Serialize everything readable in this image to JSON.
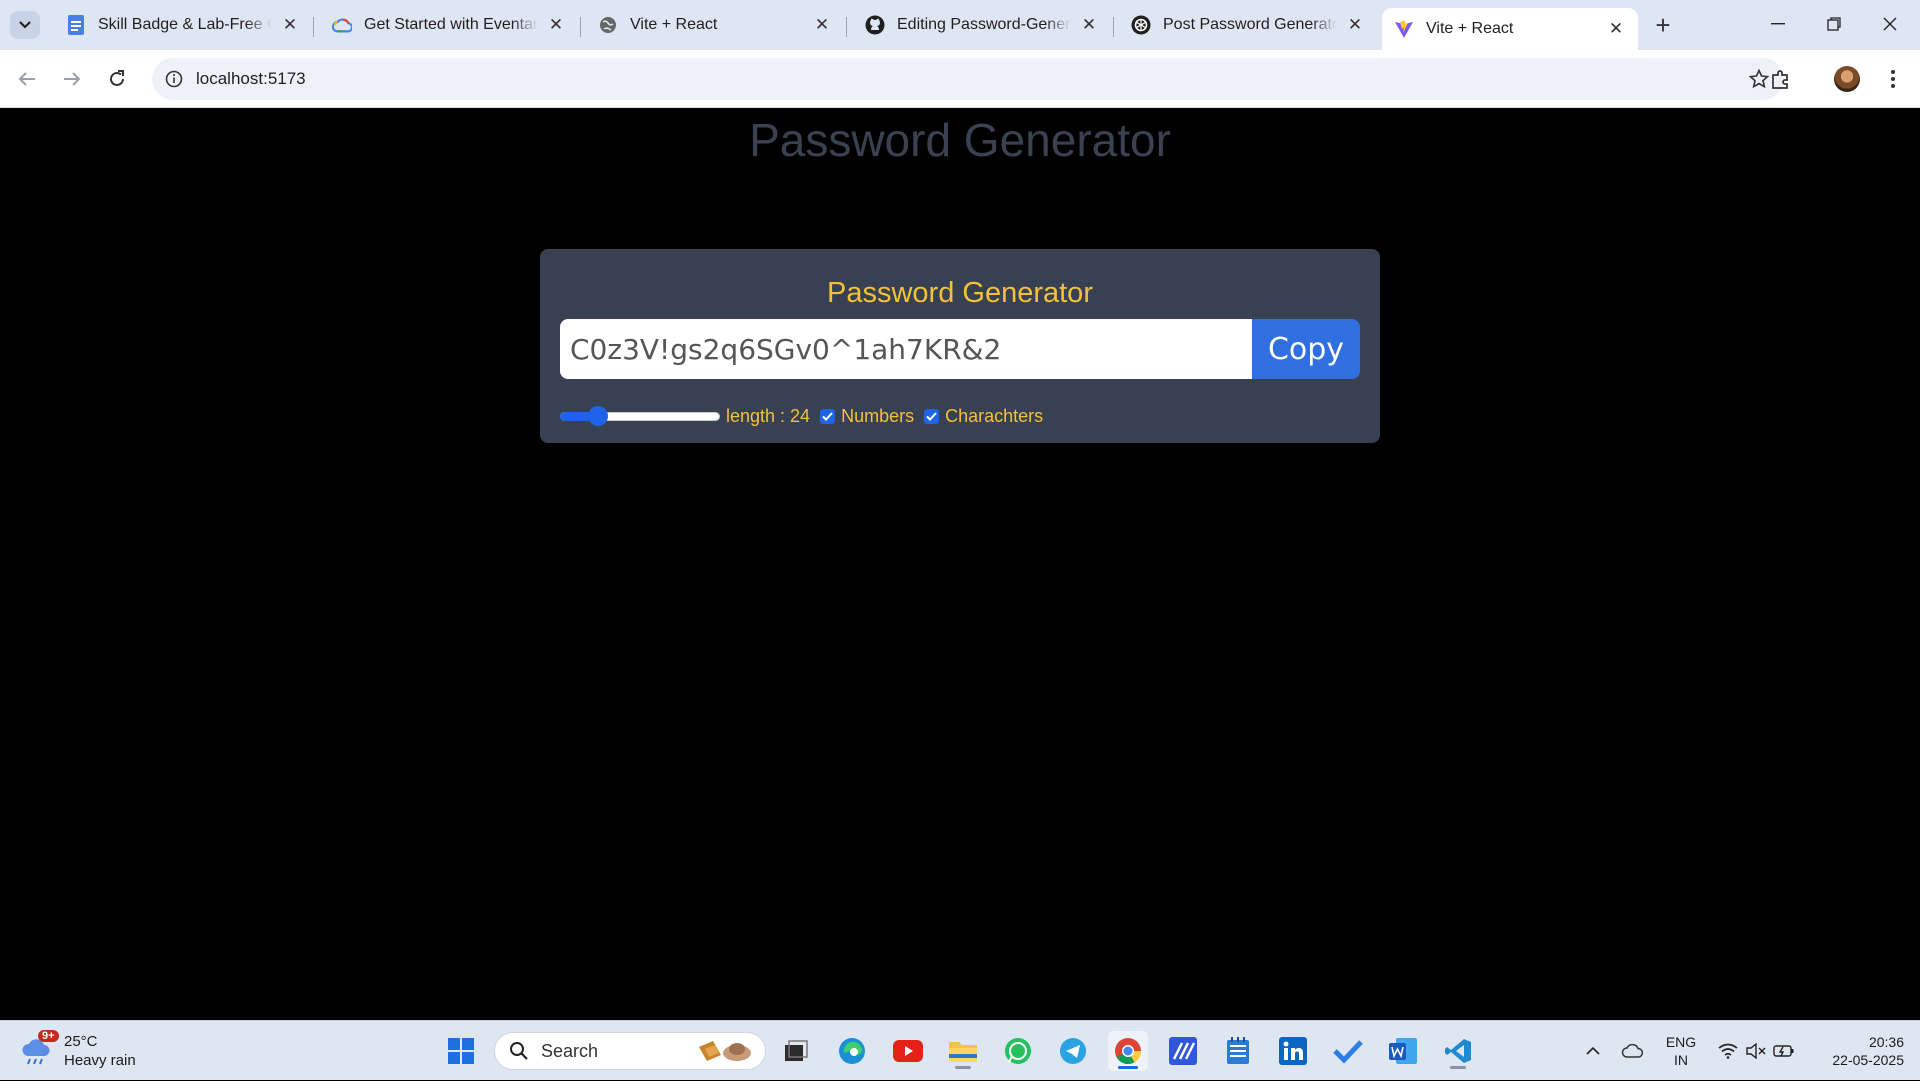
{
  "browser": {
    "tabs": [
      {
        "title": "Skill Badge & Lab-Free Co",
        "icon": "google-docs-icon"
      },
      {
        "title": "Get Started with Eventarc -",
        "icon": "google-cloud-icon"
      },
      {
        "title": "Vite + React",
        "icon": "globe-icon"
      },
      {
        "title": "Editing Password-Generato",
        "icon": "github-icon"
      },
      {
        "title": "Post Password Generator P",
        "icon": "openai-icon"
      },
      {
        "title": "Vite + React",
        "icon": "vite-icon",
        "active": true
      }
    ],
    "url": "localhost:5173"
  },
  "page": {
    "heading": "Password Generator",
    "card": {
      "title": "Password Generator",
      "password": "C0z3V!gs2q6SGv0^1ah7KR&2",
      "copy_label": "Copy",
      "length_label": "length : 24",
      "length_value": 24,
      "length_fraction": 0.24,
      "numbers_label": "Numbers",
      "numbers_checked": true,
      "characters_label": "Charachters",
      "characters_checked": true
    }
  },
  "taskbar": {
    "weather": {
      "temp": "25°C",
      "desc": "Heavy rain",
      "badge": "9+"
    },
    "search_placeholder": "Search",
    "language": {
      "line1": "ENG",
      "line2": "IN"
    },
    "clock": {
      "time": "20:36",
      "date": "22-05-2025"
    }
  },
  "colors": {
    "card_bg": "#374151",
    "accent_yellow": "#f3c13a",
    "copy_button": "#2f6fe0"
  }
}
